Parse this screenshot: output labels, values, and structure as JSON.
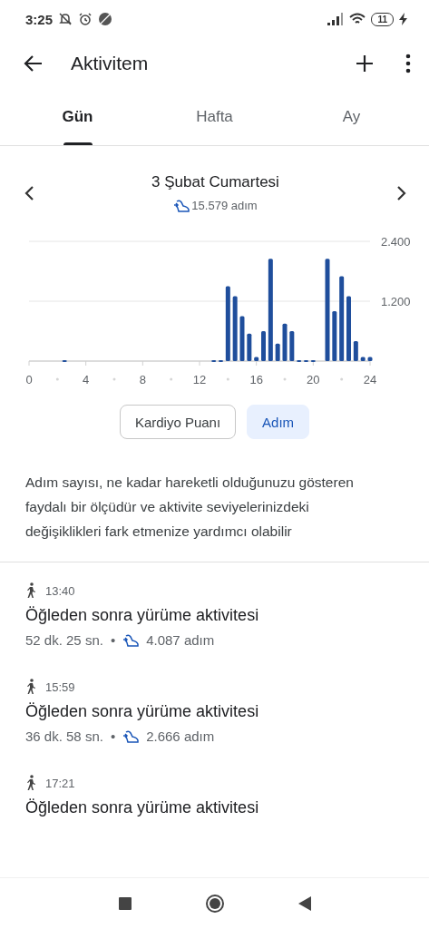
{
  "status_bar": {
    "time": "3:25",
    "battery": "11"
  },
  "app_bar": {
    "title": "Aktivitem"
  },
  "tabs": [
    {
      "label": "Gün",
      "selected": true
    },
    {
      "label": "Hafta",
      "selected": false
    },
    {
      "label": "Ay",
      "selected": false
    }
  ],
  "day": {
    "date": "3 Şubat Cumartesi",
    "steps": "15.579 adım"
  },
  "chart_data": {
    "type": "bar",
    "x": [
      2.5,
      13,
      13.5,
      14,
      14.5,
      15,
      15.5,
      16,
      16.5,
      17,
      17.5,
      18,
      18.5,
      19,
      19.5,
      20,
      21,
      21.5,
      22,
      22.5,
      23,
      23.5,
      24
    ],
    "values": [
      20,
      20,
      20,
      1500,
      1300,
      900,
      550,
      80,
      600,
      2050,
      350,
      750,
      600,
      20,
      20,
      20,
      2050,
      1000,
      1700,
      1300,
      400,
      80,
      80
    ],
    "xlim": [
      0,
      24
    ],
    "ylim": [
      0,
      2400
    ],
    "xticks": [
      0,
      4,
      8,
      12,
      16,
      20,
      24
    ],
    "yticks": [
      {
        "value": 1200,
        "label": "1.200"
      },
      {
        "value": 2400,
        "label": "2.400"
      }
    ],
    "color": "#1f4e9c"
  },
  "metric_toggle": [
    {
      "label": "Kardiyo Puanı",
      "selected": false
    },
    {
      "label": "Adım",
      "selected": true
    }
  ],
  "description": "Adım sayısı, ne kadar hareketli olduğunuzu gösteren faydalı bir ölçüdür ve aktivite seviyelerinizdeki değişiklikleri fark etmenize yardımcı olabilir",
  "activities": [
    {
      "time": "13:40",
      "title": "Öğleden sonra yürüme aktivitesi",
      "duration": "52 dk. 25 sn.",
      "separator": "•",
      "steps": "4.087 adım"
    },
    {
      "time": "15:59",
      "title": "Öğleden sonra yürüme aktivitesi",
      "duration": "36 dk. 58 sn.",
      "separator": "•",
      "steps": "2.666 adım"
    },
    {
      "time": "17:21",
      "title": "Öğleden sonra yürüme aktivitesi"
    }
  ]
}
